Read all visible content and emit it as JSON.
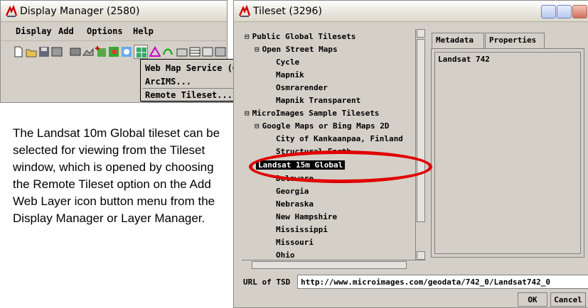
{
  "display_manager": {
    "title": "Display Manager (2580)",
    "menu": [
      "Display",
      "Add",
      "Options",
      "Help"
    ],
    "popup_menu": [
      "Web Map Service (OGC)...",
      "ArcIMS...",
      "Remote Tileset..."
    ]
  },
  "description": "The Landsat 10m Global tileset can be selected for viewing from the Tileset window, which is opened by choosing the Remote Tileset option on the Add Web Layer icon button menu from the Display Manager or Layer Manager.",
  "tileset": {
    "title": "Tileset (3296)",
    "tree": [
      {
        "label": "Public Global Tilesets",
        "expander": "⊟"
      },
      {
        "label": "Open Street Maps",
        "expander": "⊟"
      },
      {
        "label": "Cycle"
      },
      {
        "label": "Mapnik"
      },
      {
        "label": "Osmrarender"
      },
      {
        "label": "Mapnik Transparent"
      },
      {
        "label": "MicroImages Sample Tilesets",
        "expander": "⊟"
      },
      {
        "label": "Google Maps or Bing Maps 2D",
        "expander": "⊟"
      },
      {
        "label": "City of Kankaanpaa, Finland"
      },
      {
        "label": "Structural Earth"
      },
      {
        "label": "Landsat 15m Global",
        "selected": true
      },
      {
        "label": "Delaware"
      },
      {
        "label": "Georgia"
      },
      {
        "label": "Nebraska"
      },
      {
        "label": "New Hampshire"
      },
      {
        "label": "Mississippi"
      },
      {
        "label": "Missouri"
      },
      {
        "label": "Ohio"
      }
    ],
    "tabs": [
      "Metadata",
      "Properties"
    ],
    "metadata_value": "Landsat 742",
    "url_label": "URL of TSD",
    "url_value": "http://www.microimages.com/geodata/742_0/Landsat742_0",
    "ok_label": "OK",
    "cancel_label": "Cancel"
  },
  "colors": {
    "highlight_ellipse": "#e00000",
    "selection": "#000000"
  }
}
